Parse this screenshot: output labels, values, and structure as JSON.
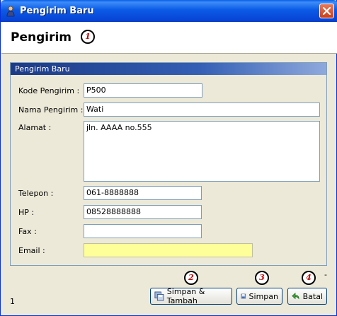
{
  "window": {
    "title": "Pengirim Baru",
    "header_title": "Pengirim"
  },
  "panel": {
    "title": "Pengirim Baru"
  },
  "form": {
    "kode_label": "Kode Pengirim :",
    "kode_value": "P500",
    "nama_label": "Nama Pengirim :",
    "nama_value": "Wati",
    "alamat_label": "Alamat :",
    "alamat_value": "jln. AAAA no.555",
    "telepon_label": "Telepon :",
    "telepon_value": "061-8888888",
    "hp_label": "HP :",
    "hp_value": "08528888888",
    "fax_label": "Fax :",
    "fax_value": "",
    "email_label": "Email :",
    "email_value": ""
  },
  "buttons": {
    "simpan_tambah": "Simpan & Tambah",
    "simpan": "Simpan",
    "batal": "Batal"
  },
  "callouts": [
    "1",
    "2",
    "3",
    "4"
  ],
  "footer": {
    "page_num": "1",
    "dash": "-"
  },
  "colors": {
    "titlebar": "#0a5fe8",
    "window_bg": "#ece9d8",
    "email_bg": "#ffff99",
    "callout_text": "#c00000"
  },
  "icons": {
    "app": "person-icon",
    "close": "close-icon",
    "simpan_tambah": "save-multiple-icon",
    "simpan": "save-icon",
    "batal": "undo-arrow-icon"
  }
}
